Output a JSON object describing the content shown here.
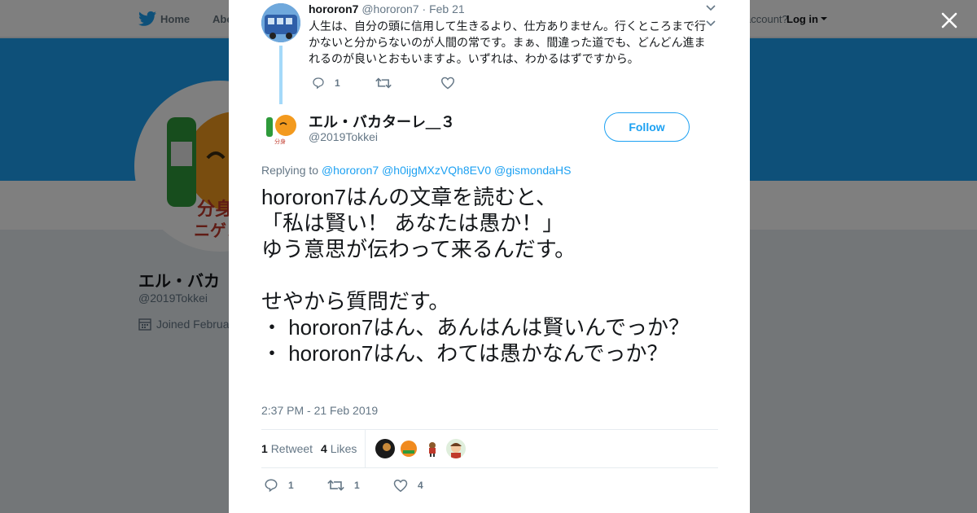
{
  "nav": {
    "home": "Home",
    "about": "Abo",
    "account_prompt": "account?",
    "login": "Log in"
  },
  "profile": {
    "name": "エル・バカ",
    "handle": "@2019Tokkei",
    "joined": "Joined Februa"
  },
  "parent_tweet": {
    "name": "hororon7",
    "handle": "@hororon7",
    "dot": "·",
    "date": "Feb 21",
    "text": "人生は、自分の頭に信用して生きるより、仕方ありません。行くところまで行かないと分からないのが人間の常です。まぁ、間違った道でも、どんどん進まれるのが良いとおもいますよ。いずれは、わかるはずですから。",
    "reply_count": "1"
  },
  "tweet": {
    "author_name": "エル・バカターレ＿３",
    "author_handle": "@2019Tokkei",
    "follow_label": "Follow",
    "replying_prefix": "Replying to",
    "mentions": [
      "@hororon7",
      "@h0ijgMXzVQh8EV0",
      "@gismondaHS"
    ],
    "text": "hororon7はんの文章を読むと、\n「私は賢い！ あなたは愚か！」\nゆう意思が伝わって来るんだす。\n\nせやから質問だす。\n・ hororon7はん、あんはんは賢いんでっか？\n・ hororon7はん、わては愚かなんでっか？",
    "timestamp": "2:37 PM - 21 Feb 2019",
    "retweet_count": "1",
    "retweet_label": "Retweet",
    "like_count": "4",
    "like_label": "Likes",
    "actions": {
      "reply": "1",
      "retweet": "1",
      "like": "4"
    }
  },
  "colors": {
    "accent": "#1da1f2",
    "banner": "#1da1f2",
    "overlay": "rgba(0,0,0,0.5)",
    "muted": "#657786"
  },
  "icons": [
    "twitter-bird-icon",
    "close-icon",
    "chevron-down-icon",
    "reply-icon",
    "retweet-icon",
    "heart-icon",
    "calendar-icon"
  ]
}
